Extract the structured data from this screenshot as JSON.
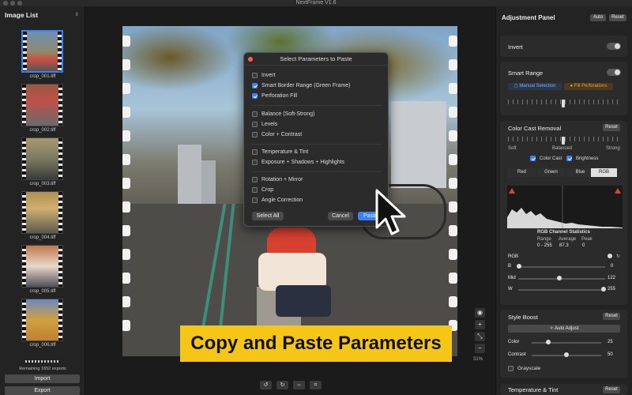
{
  "app": {
    "title": "NextFrame V1.6"
  },
  "left": {
    "title": "Image List",
    "count": "8",
    "thumbs": [
      {
        "label": "crop_001.tiff"
      },
      {
        "label": "crop_002.tiff"
      },
      {
        "label": "crop_003.tiff"
      },
      {
        "label": "crop_004.tiff"
      },
      {
        "label": "crop_005.tiff"
      },
      {
        "label": "crop_006.tiff"
      }
    ],
    "remaining": "Remaining 1652 exports",
    "import_label": "Import",
    "export_label": "Export"
  },
  "caption": "Copy and Paste Parameters",
  "zoom": "31%",
  "dialog": {
    "title": "Select Parameters to Paste",
    "options": [
      {
        "label": "Invert",
        "checked": false
      },
      {
        "label": "Smart Border Range (Green Frame)",
        "checked": true
      },
      {
        "label": "Perforation Fill",
        "checked": true
      },
      {
        "label": "Balance (Soft-Strong)",
        "checked": false
      },
      {
        "label": "Levels",
        "checked": false
      },
      {
        "label": "Color + Contrast",
        "checked": false
      },
      {
        "label": "Temperature & Tint",
        "checked": false
      },
      {
        "label": "Exposure + Shadows + Highlights",
        "checked": false
      },
      {
        "label": "Rotation + Mirror",
        "checked": false
      },
      {
        "label": "Crop",
        "checked": false
      },
      {
        "label": "Angle Correction",
        "checked": false
      }
    ],
    "select_all": "Select All",
    "cancel": "Cancel",
    "paste": "Paste"
  },
  "right": {
    "title": "Adjustment Panel",
    "auto": "Auto",
    "reset": "Reset",
    "invert": "Invert",
    "smart_range": {
      "title": "Smart Range",
      "manual": "Manual Selection",
      "fill": "Fill Perforations"
    },
    "color_cast": {
      "title": "Color Cast Removal",
      "reset": "Reset",
      "soft": "Soft",
      "balanced": "Balanced",
      "strong": "Strong",
      "chk_cast": "Color Cast",
      "chk_brightness": "Brightness",
      "channels": [
        "Red",
        "Green",
        "Blue",
        "RGB"
      ],
      "stats_title": "RGB Channel Statistics",
      "range_label": "Range",
      "avg_label": "Average",
      "peak_label": "Peak",
      "range_val": "0 - 255",
      "avg_val": "87.3",
      "peak_val": "0",
      "rgb_label": "RGB",
      "b_label": "B",
      "b_val": "0",
      "mid_label": "Mid",
      "mid_val": "122",
      "w_label": "W",
      "w_val": "255"
    },
    "style_boost": {
      "title": "Style Boost",
      "reset": "Reset",
      "auto_adjust": "Auto Adjust",
      "color_label": "Color",
      "color_val": "25",
      "contrast_label": "Contrast",
      "contrast_val": "50",
      "grayscale": "Grayscale"
    },
    "next_section": "Temperature & Tint",
    "next_reset": "Reset"
  },
  "colors": {
    "accent": "#3b82f6",
    "caption_bg": "#f5c518",
    "close": "#ff5f56",
    "fill_btn": "#f0a030"
  }
}
